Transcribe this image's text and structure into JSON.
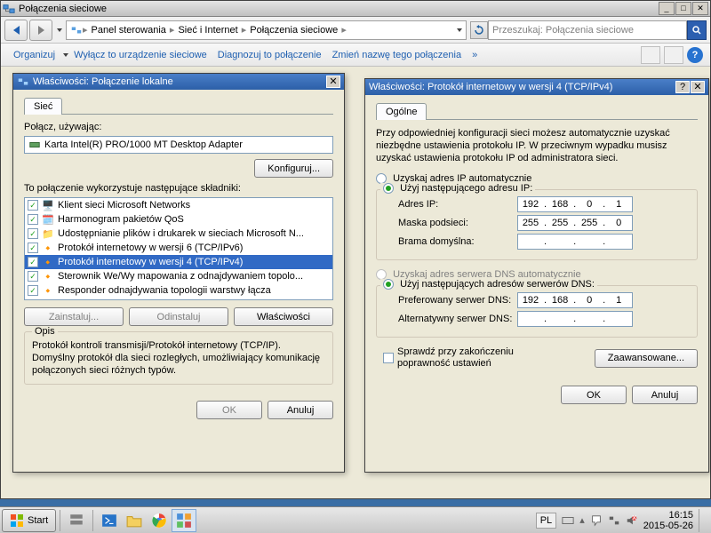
{
  "window": {
    "title": "Połączenia sieciowe"
  },
  "breadcrumb": {
    "item1": "Panel sterowania",
    "item2": "Sieć i Internet",
    "item3": "Połączenia sieciowe"
  },
  "search": {
    "placeholder": "Przeszukaj: Połączenia sieciowe"
  },
  "cmdbar": {
    "organize": "Organizuj",
    "disable": "Wyłącz to urządzenie sieciowe",
    "diagnose": "Diagnozuj to połączenie",
    "rename": "Zmień nazwę tego połączenia",
    "more": "»"
  },
  "dlg1": {
    "title": "Właściwości: Połączenie lokalne",
    "tab": "Sieć",
    "connect_using": "Połącz, używając:",
    "adapter": "Karta Intel(R) PRO/1000 MT Desktop Adapter",
    "configure": "Konfiguruj...",
    "components_label": "To połączenie wykorzystuje następujące składniki:",
    "items": [
      "Klient sieci Microsoft Networks",
      "Harmonogram pakietów QoS",
      "Udostępnianie plików i drukarek w sieciach Microsoft N...",
      "Protokół internetowy w wersji 6 (TCP/IPv6)",
      "Protokół internetowy w wersji 4 (TCP/IPv4)",
      "Sterownik We/Wy mapowania z odnajdywaniem topolo...",
      "Responder odnajdywania topologii warstwy łącza"
    ],
    "install": "Zainstaluj...",
    "uninstall": "Odinstaluj",
    "properties": "Właściwości",
    "desc_title": "Opis",
    "desc_text": "Protokół kontroli transmisji/Protokół internetowy (TCP/IP). Domyślny protokół dla sieci rozległych, umożliwiający komunikację połączonych sieci różnych typów.",
    "ok": "OK",
    "cancel": "Anuluj"
  },
  "dlg2": {
    "title": "Właściwości: Protokół internetowy w wersji 4 (TCP/IPv4)",
    "tab": "Ogólne",
    "intro": "Przy odpowiedniej konfiguracji sieci możesz automatycznie uzyskać niezbędne ustawienia protokołu IP. W przeciwnym wypadku musisz uzyskać ustawienia protokołu IP od administratora sieci.",
    "ip_auto": "Uzyskaj adres IP automatycznie",
    "ip_manual": "Użyj następującego adresu IP:",
    "ip_label": "Adres IP:",
    "mask_label": "Maska podsieci:",
    "gw_label": "Brama domyślna:",
    "ip": [
      "192",
      "168",
      "0",
      "1"
    ],
    "mask": [
      "255",
      "255",
      "255",
      "0"
    ],
    "gw": [
      "",
      "",
      "",
      ""
    ],
    "dns_auto": "Uzyskaj adres serwera DNS automatycznie",
    "dns_manual": "Użyj następujących adresów serwerów DNS:",
    "dns1_label": "Preferowany serwer DNS:",
    "dns2_label": "Alternatywny serwer DNS:",
    "dns1": [
      "192",
      "168",
      "0",
      "1"
    ],
    "dns2": [
      "",
      "",
      "",
      ""
    ],
    "validate": "Sprawdź przy zakończeniu poprawność ustawień",
    "advanced": "Zaawansowane...",
    "ok": "OK",
    "cancel": "Anuluj"
  },
  "taskbar": {
    "start": "Start",
    "lang": "PL",
    "time": "16:15",
    "date": "2015-05-26"
  }
}
